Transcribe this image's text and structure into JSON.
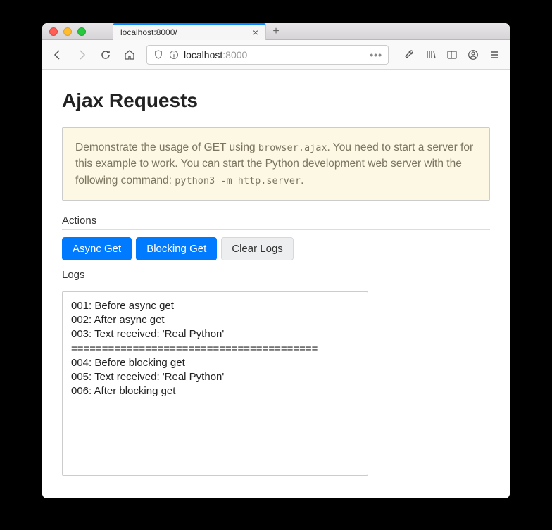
{
  "browser": {
    "tab_title": "localhost:8000/",
    "url_host": "localhost",
    "url_port": ":8000"
  },
  "page": {
    "heading": "Ajax Requests",
    "callout": {
      "part1": "Demonstrate the usage of GET using ",
      "code1": "browser.ajax",
      "part2": ". You need to start a server for this example to work. You can start the Python development web server with the following command: ",
      "code2": "python3 -m http.server",
      "part3": "."
    },
    "actions_label": "Actions",
    "buttons": {
      "async_get": "Async Get",
      "blocking_get": "Blocking Get",
      "clear_logs": "Clear Logs"
    },
    "logs_label": "Logs",
    "log_lines": [
      "001: Before async get",
      "002: After async get",
      "003: Text received: 'Real Python'",
      "========================================",
      "004: Before blocking get",
      "005: Text received: 'Real Python'",
      "006: After blocking get"
    ]
  }
}
